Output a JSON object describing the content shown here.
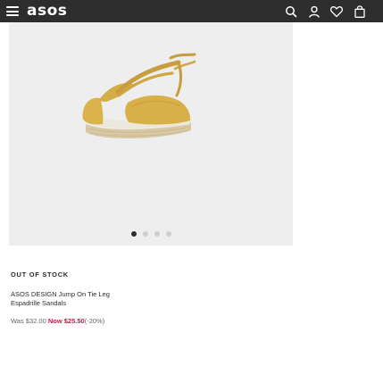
{
  "header": {
    "logo": "asos",
    "icons": [
      "menu-icon",
      "search-icon",
      "account-icon",
      "saved-icon",
      "bag-icon"
    ],
    "colors": {
      "background": "#2d2d2d",
      "foreground": "#ffffff"
    }
  },
  "product": {
    "image": {
      "subject": "espadrille sandal",
      "color": "#d9b34c"
    },
    "carousel": {
      "count": 4,
      "active_index": 0
    },
    "stock_label": "OUT OF STOCK",
    "title_line1": "ASOS DESIGN Jump On Tie Leg",
    "title_line2": "Espadrille Sandals",
    "price": {
      "was_label": "Was $32.00",
      "now_label": "Now $25.50",
      "discount": "(-20%)"
    }
  },
  "colors": {
    "accent": "#d01345",
    "gallery_bg": "#eeeeee",
    "text": "#2d2d2d"
  }
}
